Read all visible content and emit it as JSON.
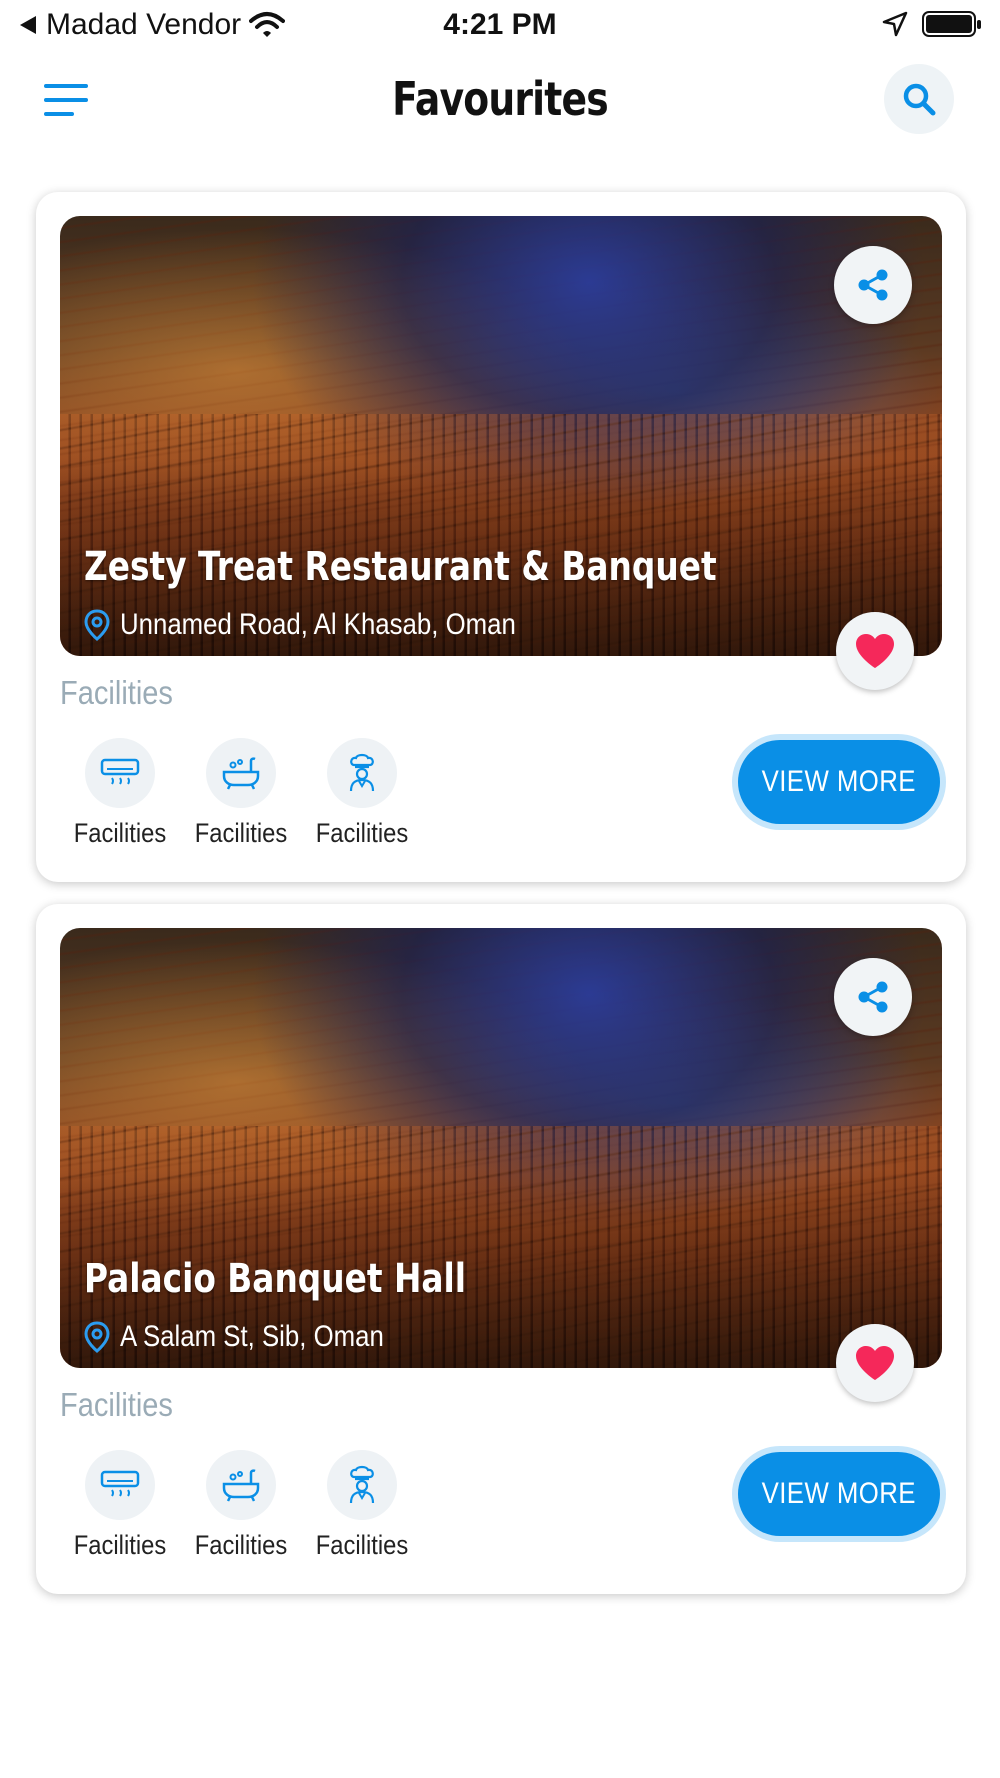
{
  "status_bar": {
    "carrier": "Madad Vendor",
    "time": "4:21 PM"
  },
  "header": {
    "title": "Favourites"
  },
  "colors": {
    "accent": "#0a8fe6",
    "heart": "#f5285a",
    "muted": "#9aabb6"
  },
  "venues": [
    {
      "name": "Zesty Treat Restaurant & Banquet",
      "address": "Unnamed Road, Al Khasab, Oman",
      "facilities_heading": "Facilities",
      "facilities": [
        {
          "icon": "air-conditioner-icon",
          "label": "Facilities"
        },
        {
          "icon": "bathtub-icon",
          "label": "Facilities"
        },
        {
          "icon": "chef-icon",
          "label": "Facilities"
        }
      ],
      "button_label": "VIEW MORE",
      "favourite": true
    },
    {
      "name": "Palacio Banquet Hall",
      "address": "A Salam St, Sib, Oman",
      "facilities_heading": "Facilities",
      "facilities": [
        {
          "icon": "air-conditioner-icon",
          "label": "Facilities"
        },
        {
          "icon": "bathtub-icon",
          "label": "Facilities"
        },
        {
          "icon": "chef-icon",
          "label": "Facilities"
        }
      ],
      "button_label": "VIEW MORE",
      "favourite": true
    }
  ]
}
